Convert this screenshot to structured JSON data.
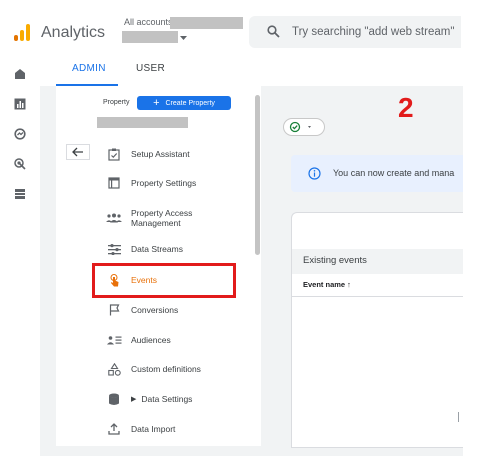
{
  "header": {
    "app_title": "Analytics",
    "account_breadcrumb": "All accounts >",
    "search_placeholder": "Try searching \"add web stream\""
  },
  "tabs": [
    {
      "label": "ADMIN",
      "active": true
    },
    {
      "label": "USER",
      "active": false
    }
  ],
  "admin_panel": {
    "property_label": "Property",
    "create_property_label": "Create Property",
    "items": [
      {
        "label": "Setup Assistant",
        "icon": "clipboard-check-icon"
      },
      {
        "label": "Property Settings",
        "icon": "window-icon"
      },
      {
        "label": "Property Access Management",
        "line1": "Property Access",
        "line2": "Management",
        "icon": "people-icon"
      },
      {
        "label": "Data Streams",
        "icon": "streams-icon"
      },
      {
        "label": "Events",
        "icon": "touch-icon",
        "highlighted": true
      },
      {
        "label": "Conversions",
        "icon": "flag-icon"
      },
      {
        "label": "Audiences",
        "icon": "audience-icon"
      },
      {
        "label": "Custom definitions",
        "icon": "shapes-icon"
      },
      {
        "label": "Data Settings",
        "icon": "database-icon"
      },
      {
        "label": "Data Import",
        "icon": "upload-icon"
      }
    ]
  },
  "annotation": {
    "step": "2"
  },
  "main": {
    "info_banner_text": "You can now create and mana",
    "events_table": {
      "section_title": "Existing events",
      "column_event_name": "Event name ↑"
    }
  },
  "colors": {
    "accent_blue": "#1a73e8",
    "events_orange": "#e8710a",
    "highlight_red": "#e21b1b",
    "logo_orange": "#f9ab00",
    "logo_dark_orange": "#e37400"
  }
}
